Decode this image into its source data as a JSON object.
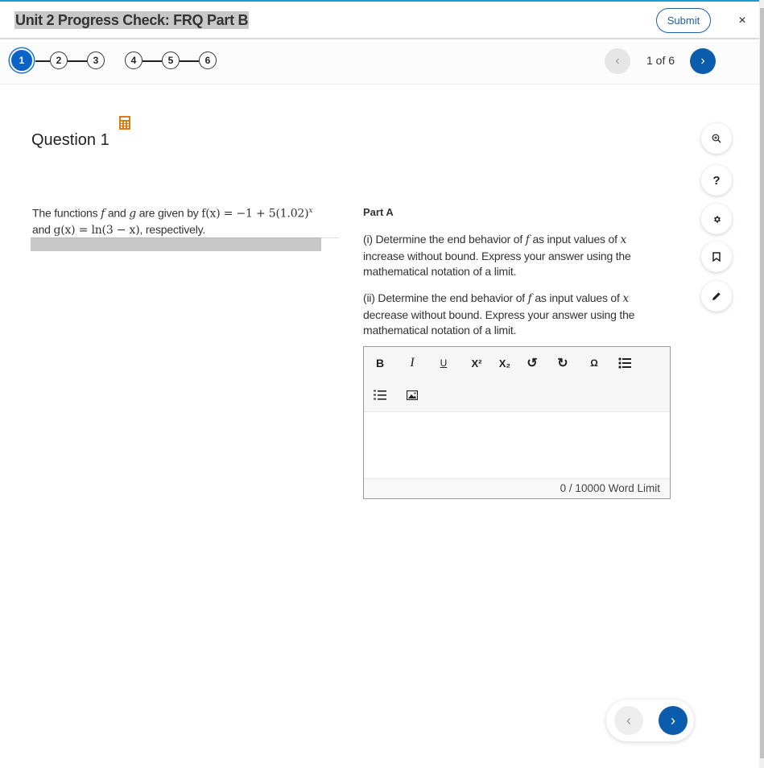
{
  "header": {
    "title": "Unit 2 Progress Check: FRQ Part B",
    "submit_label": "Submit",
    "close_symbol": "×"
  },
  "steps": {
    "items": [
      "1",
      "2",
      "3",
      "4",
      "5",
      "6"
    ],
    "active": "1"
  },
  "pager": {
    "count_text": "1 of 6",
    "prev_symbol": "‹",
    "next_symbol": "›"
  },
  "question": {
    "title": "Question 1",
    "calculator_icon": "calculator-icon",
    "stimulus": {
      "t1": "The functions ",
      "f": "f",
      "t2": " and ",
      "g": "g",
      "t3": " are given by ",
      "f_def": "f(x) = −1 + 5(1.02)",
      "f_exp": "x",
      "t4": "and ",
      "g_def": "g(x) = ln(3 − x)",
      "t5": ", respectively."
    }
  },
  "part": {
    "label": "Part A",
    "prompt1": {
      "a": "(i) Determine the end behavior of ",
      "f": "f",
      "b": " as input values of ",
      "x": "x",
      "c": " increase without bound. Express your answer using the mathematical notation of a limit."
    },
    "prompt2": {
      "a": "(ii) Determine the end behavior of ",
      "f": "f",
      "b": " as input values of ",
      "x": "x",
      "c": " decrease without bound. Express your answer using the mathematical notation of a limit."
    }
  },
  "editor": {
    "toolbar": [
      {
        "name": "bold",
        "symbol": "B"
      },
      {
        "name": "italic",
        "symbol": "I"
      },
      {
        "name": "underline",
        "symbol": "U"
      },
      {
        "name": "superscript",
        "symbol": "X²"
      },
      {
        "name": "subscript",
        "symbol": "X₂"
      },
      {
        "name": "undo",
        "symbol": "↺"
      },
      {
        "name": "redo",
        "symbol": "↻"
      },
      {
        "name": "special-character",
        "symbol": "Ω"
      },
      {
        "name": "bulleted-list",
        "symbol": "☰"
      },
      {
        "name": "numbered-list",
        "symbol": "☰"
      },
      {
        "name": "insert-image",
        "symbol": "▣"
      }
    ],
    "value": "",
    "word_count": "0 / 10000 Word Limit"
  },
  "sidebar_tools": [
    "zoom-in",
    "help",
    "settings",
    "bookmark",
    "annotate"
  ],
  "help_symbol": "?"
}
